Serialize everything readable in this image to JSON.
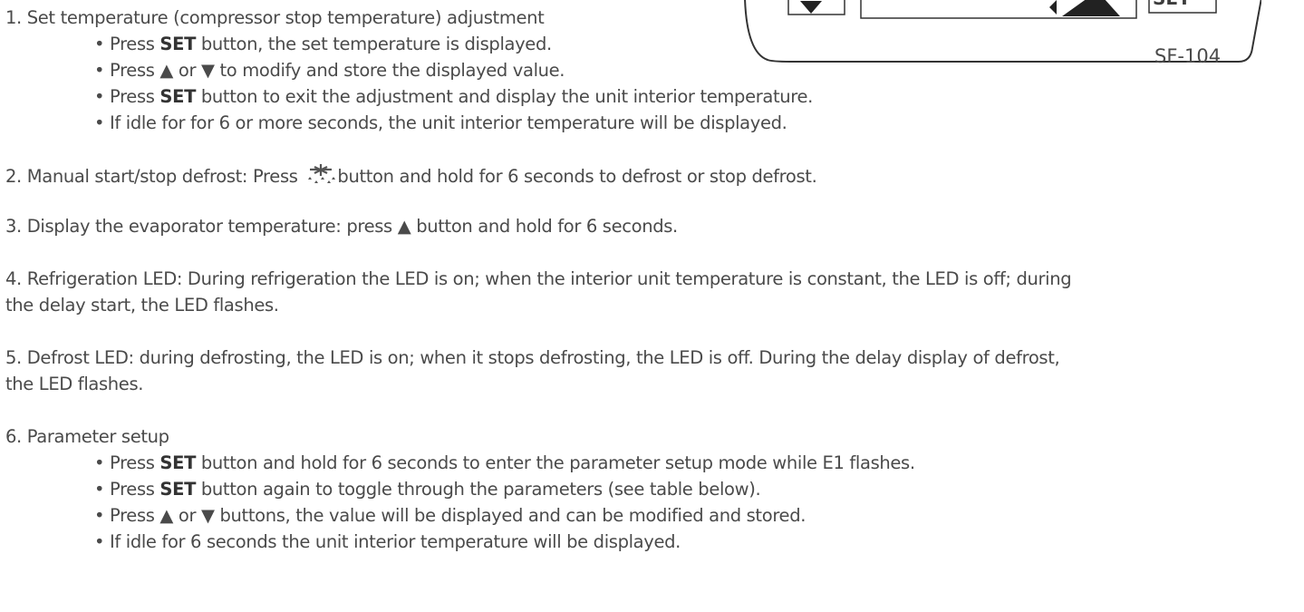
{
  "panel": {
    "model": "SF-104",
    "set_label": "SET",
    "down_icon": "down-triangle-icon",
    "up_icon": "up-triangle-icon"
  },
  "sections": {
    "s1": {
      "title": "1. Set temperature (compressor stop temperature) adjustment",
      "b1_pre": "• Press ",
      "b1_bold": "SET",
      "b1_post": " button, the set temperature is displayed.",
      "b2": "• Press ▲  or  ▼  to modify and store the displayed value.",
      "b3_pre": "• Press ",
      "b3_bold": "SET",
      "b3_post": " button to exit the adjustment and display the unit interior temperature.",
      "b4": "• If idle for for 6 or more seconds, the unit interior temperature will be displayed."
    },
    "s2": {
      "pre": "2. Manual start/stop defrost: Press ",
      "icon": "defrost-icon",
      "post": "button and hold for 6 seconds to defrost or stop defrost."
    },
    "s3": {
      "text": "3. Display the evaporator temperature: press ▲  button and hold for 6 seconds."
    },
    "s4": {
      "line1": "4. Refrigeration LED: During refrigeration the LED is on; when the interior unit temperature is constant, the LED is off; during",
      "line2": "the delay start, the LED flashes."
    },
    "s5": {
      "line1": "5. Defrost LED: during defrosting, the LED is on; when it stops defrosting, the LED is off. During the delay display of defrost,",
      "line2": "the LED flashes."
    },
    "s6": {
      "title": "6. Parameter setup",
      "b1_pre": "• Press ",
      "b1_bold": "SET",
      "b1_post": " button and hold for 6 seconds to enter the parameter setup mode while E1 flashes.",
      "b2_pre": "• Press ",
      "b2_bold": "SET",
      "b2_post": " button again to toggle through the parameters (see table below).",
      "b3": "• Press ▲  or  ▼  buttons, the value will be displayed and can be modified and stored.",
      "b4": "• If idle for 6 seconds the unit interior temperature will be displayed."
    }
  }
}
